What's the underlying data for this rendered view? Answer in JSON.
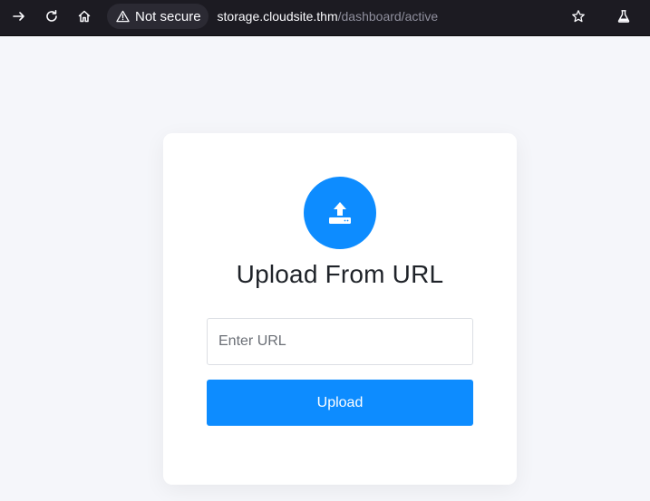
{
  "browser": {
    "security_label": "Not secure",
    "url_host": "storage.cloudsite.thm",
    "url_path": "/dashboard/active"
  },
  "card": {
    "title": "Upload From URL",
    "input_placeholder": "Enter URL",
    "input_value": "",
    "button_label": "Upload"
  },
  "icons": {
    "forward": "arrow-right-icon",
    "reload": "reload-icon",
    "home": "home-icon",
    "warning": "warning-triangle-icon",
    "bookmark": "star-icon",
    "labs": "flask-icon",
    "upload": "upload-icon"
  },
  "colors": {
    "accent": "#0d8cff",
    "browser_bg": "#1c1b22",
    "page_bg": "#f5f6fa",
    "card_bg": "#ffffff"
  }
}
